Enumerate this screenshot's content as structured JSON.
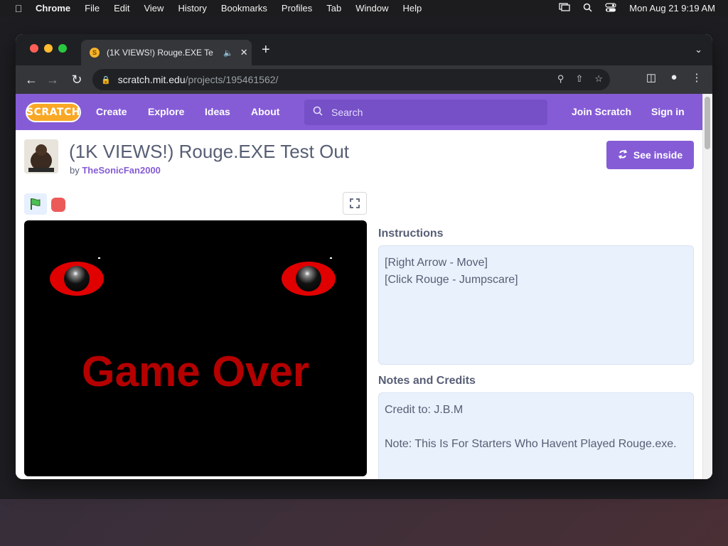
{
  "menubar": {
    "app_name": "Chrome",
    "items": [
      "File",
      "Edit",
      "View",
      "History",
      "Bookmarks",
      "Profiles",
      "Tab",
      "Window",
      "Help"
    ],
    "clock": "Mon Aug 21  9:19 AM"
  },
  "browser": {
    "tab_title": "(1K VIEWS!) Rouge.EXE Te",
    "url_host": "scratch.mit.edu",
    "url_path": "/projects/195461562/"
  },
  "scratch_nav": {
    "logo": "SCRATCH",
    "links": [
      "Create",
      "Explore",
      "Ideas",
      "About"
    ],
    "search_placeholder": "Search",
    "join": "Join Scratch",
    "signin": "Sign in"
  },
  "project": {
    "title": "(1K VIEWS!) Rouge.EXE Test Out",
    "by_prefix": "by",
    "author": "TheSonicFan2000",
    "see_inside": "See inside",
    "stage_text": "Game Over"
  },
  "instructions": {
    "heading": "Instructions",
    "text": "[Right Arrow - Move]\n[Click Rouge - Jumpscare]"
  },
  "notes": {
    "heading": "Notes and Credits",
    "text": "Credit to: J.B.M\n\nNote: This Is For Starters Who Havent Played Rouge.exe."
  },
  "colors": {
    "scratch_purple": "#855cd6",
    "stage_text_red": "#b50000"
  }
}
